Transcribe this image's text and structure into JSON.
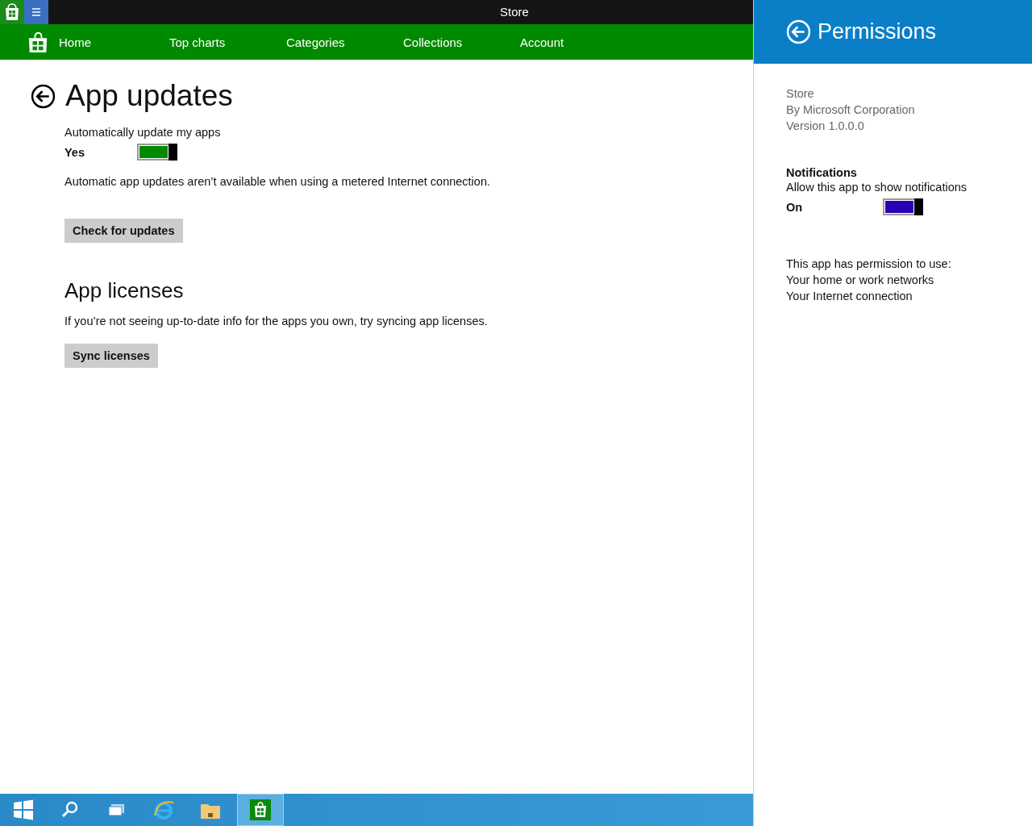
{
  "window": {
    "title": "Store"
  },
  "nav": [
    {
      "label": "Home"
    },
    {
      "label": "Top charts"
    },
    {
      "label": "Categories"
    },
    {
      "label": "Collections"
    },
    {
      "label": "Account"
    }
  ],
  "page": {
    "title": "App updates",
    "auto_update": {
      "label": "Automatically update my apps",
      "state_text": "Yes",
      "on": true
    },
    "note": "Automatic app updates aren’t available when using a metered Internet connection.",
    "check_button": "Check for updates",
    "licenses_title": "App licenses",
    "licenses_text": "If you’re not seeing up-to-date info for the apps you own, try syncing app licenses.",
    "sync_button": "Sync licenses"
  },
  "permissions": {
    "title": "Permissions",
    "app_info": [
      "Store",
      "By Microsoft Corporation",
      "Version 1.0.0.0"
    ],
    "notifications": {
      "heading": "Notifications",
      "label": "Allow this app to show notifications",
      "state_text": "On",
      "on": true
    },
    "uses_heading": "This app has permission to use:",
    "uses": [
      "Your home or work networks",
      "Your Internet connection"
    ]
  },
  "taskbar": [
    {
      "kind": "start",
      "selected": false
    },
    {
      "kind": "search",
      "selected": false
    },
    {
      "kind": "task-view",
      "selected": false
    },
    {
      "kind": "browser",
      "selected": false
    },
    {
      "kind": "folder",
      "selected": false
    },
    {
      "kind": "store",
      "selected": true
    }
  ]
}
